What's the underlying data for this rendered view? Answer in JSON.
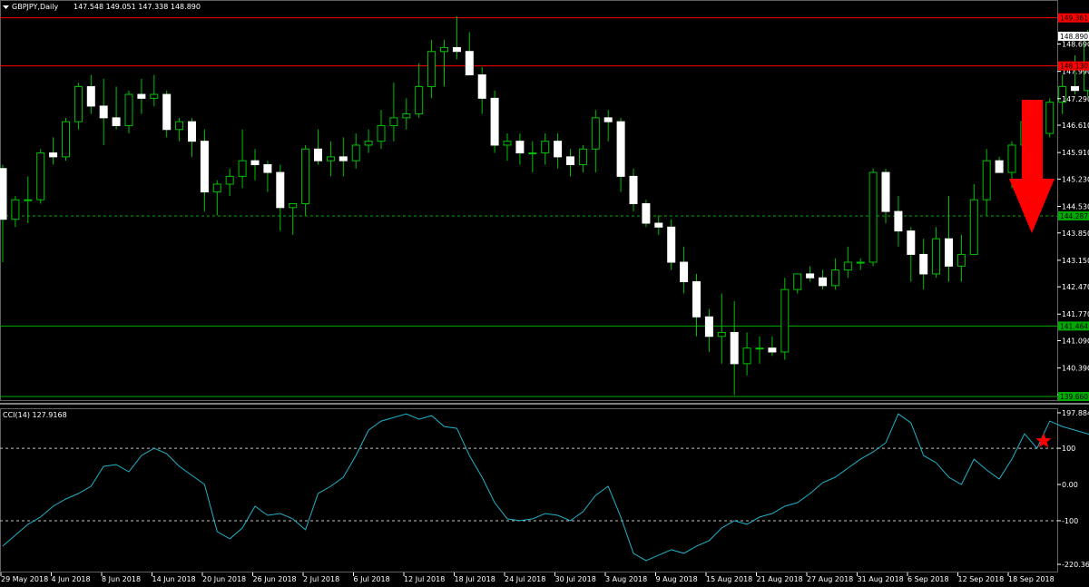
{
  "header": {
    "symbol": "GBPJPY,Daily",
    "ohlc": "147.548 149.051 147.338 148.890"
  },
  "indicator": {
    "label": "CCI(14) 127.9168"
  },
  "colors": {
    "background": "#000000",
    "candle_up": "#000000",
    "candle_down": "#ffffff",
    "wick": "#00c000",
    "cci_line": "#20b2c8",
    "red_level": "#ff0000",
    "green_level": "#00aa00",
    "arrow": "#ff0000"
  },
  "chart_data": {
    "type": "candlestick",
    "price_ticks": [
      "148.690",
      "147.990",
      "147.290",
      "146.610",
      "145.910",
      "145.230",
      "144.530",
      "143.850",
      "143.150",
      "142.470",
      "141.770",
      "141.090",
      "140.390",
      "139.710"
    ],
    "price_range": [
      139.6,
      149.9
    ],
    "levels": [
      {
        "price": 149.361,
        "label": "149.361",
        "color": "red",
        "style": "solid"
      },
      {
        "price": 148.13,
        "label": "148.130",
        "color": "red",
        "style": "solid"
      },
      {
        "price": 144.287,
        "label": "144.287",
        "color": "green",
        "style": "dashed"
      },
      {
        "price": 141.464,
        "label": "141.464",
        "color": "green",
        "style": "solid"
      },
      {
        "price": 139.66,
        "label": "139.660",
        "color": "green",
        "style": "solid"
      }
    ],
    "current_price": {
      "price": 148.89,
      "label": "148.890"
    },
    "date_labels": [
      "29 May 2018",
      "4 Jun 2018",
      "8 Jun 2018",
      "14 Jun 2018",
      "20 Jun 2018",
      "26 Jun 2018",
      "2 Jul 2018",
      "6 Jul 2018",
      "12 Jul 2018",
      "18 Jul 2018",
      "24 Jul 2018",
      "30 Jul 2018",
      "3 Aug 2018",
      "9 Aug 2018",
      "15 Aug 2018",
      "21 Aug 2018",
      "27 Aug 2018",
      "31 Aug 2018",
      "6 Sep 2018",
      "12 Sep 2018",
      "18 Sep 2018"
    ],
    "candles": [
      [
        145.5,
        145.6,
        143.1,
        144.2
      ],
      [
        144.2,
        144.8,
        144.0,
        144.7
      ],
      [
        144.7,
        145.3,
        144.1,
        144.7
      ],
      [
        144.7,
        146.0,
        144.6,
        145.9
      ],
      [
        145.9,
        146.3,
        145.6,
        145.8
      ],
      [
        145.8,
        146.8,
        145.7,
        146.7
      ],
      [
        146.7,
        147.7,
        146.5,
        147.6
      ],
      [
        147.6,
        147.9,
        146.9,
        147.1
      ],
      [
        147.1,
        147.8,
        146.1,
        146.8
      ],
      [
        146.8,
        147.6,
        146.5,
        146.6
      ],
      [
        146.6,
        147.5,
        146.4,
        147.4
      ],
      [
        147.4,
        147.8,
        146.9,
        147.3
      ],
      [
        147.3,
        147.9,
        147.1,
        147.4
      ],
      [
        147.4,
        147.5,
        146.3,
        146.5
      ],
      [
        146.5,
        146.8,
        146.2,
        146.7
      ],
      [
        146.7,
        146.8,
        145.8,
        146.2
      ],
      [
        146.2,
        146.5,
        144.4,
        144.9
      ],
      [
        144.9,
        145.2,
        144.3,
        145.1
      ],
      [
        145.1,
        145.5,
        144.8,
        145.3
      ],
      [
        145.3,
        146.5,
        145.0,
        145.7
      ],
      [
        145.7,
        146.0,
        145.2,
        145.6
      ],
      [
        145.6,
        145.7,
        144.9,
        145.4
      ],
      [
        145.4,
        145.6,
        143.9,
        144.5
      ],
      [
        144.5,
        144.6,
        143.8,
        144.6
      ],
      [
        144.6,
        146.1,
        144.3,
        146.0
      ],
      [
        146.0,
        146.5,
        145.6,
        145.7
      ],
      [
        145.7,
        146.2,
        145.3,
        145.8
      ],
      [
        145.8,
        146.3,
        145.3,
        145.7
      ],
      [
        145.7,
        146.4,
        145.5,
        146.1
      ],
      [
        146.1,
        146.5,
        145.9,
        146.2
      ],
      [
        146.2,
        147.0,
        146.0,
        146.6
      ],
      [
        146.6,
        147.7,
        146.2,
        146.8
      ],
      [
        146.8,
        147.3,
        146.5,
        146.9
      ],
      [
        146.9,
        148.2,
        146.8,
        147.6
      ],
      [
        147.6,
        148.8,
        147.3,
        148.5
      ],
      [
        148.5,
        148.8,
        147.6,
        148.6
      ],
      [
        148.6,
        149.4,
        148.3,
        148.5
      ],
      [
        148.5,
        149.0,
        147.9,
        147.9
      ],
      [
        147.9,
        148.1,
        146.9,
        147.3
      ],
      [
        147.3,
        147.5,
        145.9,
        146.1
      ],
      [
        146.1,
        146.4,
        145.7,
        146.2
      ],
      [
        146.2,
        146.4,
        145.6,
        145.9
      ],
      [
        145.9,
        146.2,
        145.4,
        145.9
      ],
      [
        145.9,
        146.4,
        145.6,
        146.2
      ],
      [
        146.2,
        146.4,
        145.5,
        145.8
      ],
      [
        145.8,
        146.0,
        145.3,
        145.6
      ],
      [
        145.6,
        146.1,
        145.4,
        146.0
      ],
      [
        146.0,
        147.0,
        145.4,
        146.8
      ],
      [
        146.8,
        147.0,
        146.2,
        146.7
      ],
      [
        146.7,
        146.8,
        144.9,
        145.3
      ],
      [
        145.3,
        145.5,
        144.4,
        144.6
      ],
      [
        144.6,
        144.7,
        144.0,
        144.1
      ],
      [
        144.1,
        144.3,
        143.8,
        144.0
      ],
      [
        144.0,
        144.2,
        142.9,
        143.1
      ],
      [
        143.1,
        143.5,
        142.3,
        142.6
      ],
      [
        142.6,
        142.8,
        141.2,
        141.7
      ],
      [
        141.7,
        141.9,
        140.8,
        141.2
      ],
      [
        141.2,
        142.3,
        140.5,
        141.3
      ],
      [
        141.3,
        142.1,
        139.7,
        140.5
      ],
      [
        140.5,
        141.3,
        140.2,
        140.9
      ],
      [
        140.9,
        141.2,
        140.5,
        140.9
      ],
      [
        140.9,
        141.2,
        140.7,
        140.8
      ],
      [
        140.8,
        142.7,
        140.6,
        142.4
      ],
      [
        142.4,
        142.8,
        142.3,
        142.8
      ],
      [
        142.8,
        143.0,
        142.6,
        142.7
      ],
      [
        142.7,
        142.9,
        142.4,
        142.5
      ],
      [
        142.5,
        143.2,
        142.4,
        142.9
      ],
      [
        142.9,
        143.5,
        142.7,
        143.1
      ],
      [
        143.1,
        143.2,
        142.9,
        143.1
      ],
      [
        143.1,
        145.5,
        143.0,
        145.4
      ],
      [
        145.4,
        145.5,
        144.1,
        144.4
      ],
      [
        144.4,
        144.8,
        143.5,
        143.9
      ],
      [
        143.9,
        144.0,
        142.6,
        143.3
      ],
      [
        143.3,
        143.7,
        142.4,
        142.8
      ],
      [
        142.8,
        144.0,
        142.7,
        143.7
      ],
      [
        143.7,
        144.8,
        142.6,
        143.0
      ],
      [
        143.0,
        143.8,
        142.6,
        143.3
      ],
      [
        143.3,
        145.1,
        143.3,
        144.7
      ],
      [
        144.7,
        146.0,
        144.3,
        145.7
      ],
      [
        145.7,
        145.8,
        145.4,
        145.4
      ],
      [
        145.4,
        146.2,
        145.0,
        146.1
      ],
      [
        146.1,
        146.8,
        145.9,
        146.7
      ],
      [
        146.7,
        146.8,
        146.2,
        146.4
      ],
      [
        146.4,
        147.3,
        146.3,
        147.2
      ],
      [
        147.2,
        147.9,
        146.9,
        147.6
      ],
      [
        147.6,
        148.4,
        147.4,
        147.5
      ],
      [
        147.5,
        149.05,
        147.34,
        148.89
      ]
    ],
    "cci": {
      "title": "CCI(14) 127.9168",
      "ticks": [
        "197.8846",
        "100",
        "0.00",
        "-100",
        "-220.3629"
      ],
      "range": [
        -220.3629,
        197.8846
      ],
      "dashed_levels": [
        100,
        -100
      ],
      "values": [
        -170,
        -140,
        -110,
        -90,
        -60,
        -40,
        -25,
        -5,
        50,
        55,
        35,
        80,
        100,
        85,
        50,
        25,
        0,
        -130,
        -150,
        -120,
        -60,
        -85,
        -80,
        -95,
        -125,
        -25,
        -5,
        20,
        80,
        150,
        175,
        185,
        195,
        180,
        190,
        160,
        155,
        80,
        20,
        -50,
        -95,
        -100,
        -95,
        -80,
        -85,
        -100,
        -75,
        -30,
        -5,
        -90,
        -190,
        -210,
        -195,
        -180,
        -190,
        -170,
        -155,
        -120,
        -100,
        -110,
        -90,
        -80,
        -60,
        -50,
        -25,
        5,
        20,
        45,
        70,
        90,
        115,
        195,
        170,
        80,
        60,
        20,
        0,
        70,
        40,
        15,
        70,
        140,
        100,
        175,
        160,
        150,
        140,
        130,
        130
      ]
    },
    "marker": {
      "type": "star",
      "value": 100
    },
    "arrow": {
      "direction": "down"
    }
  }
}
